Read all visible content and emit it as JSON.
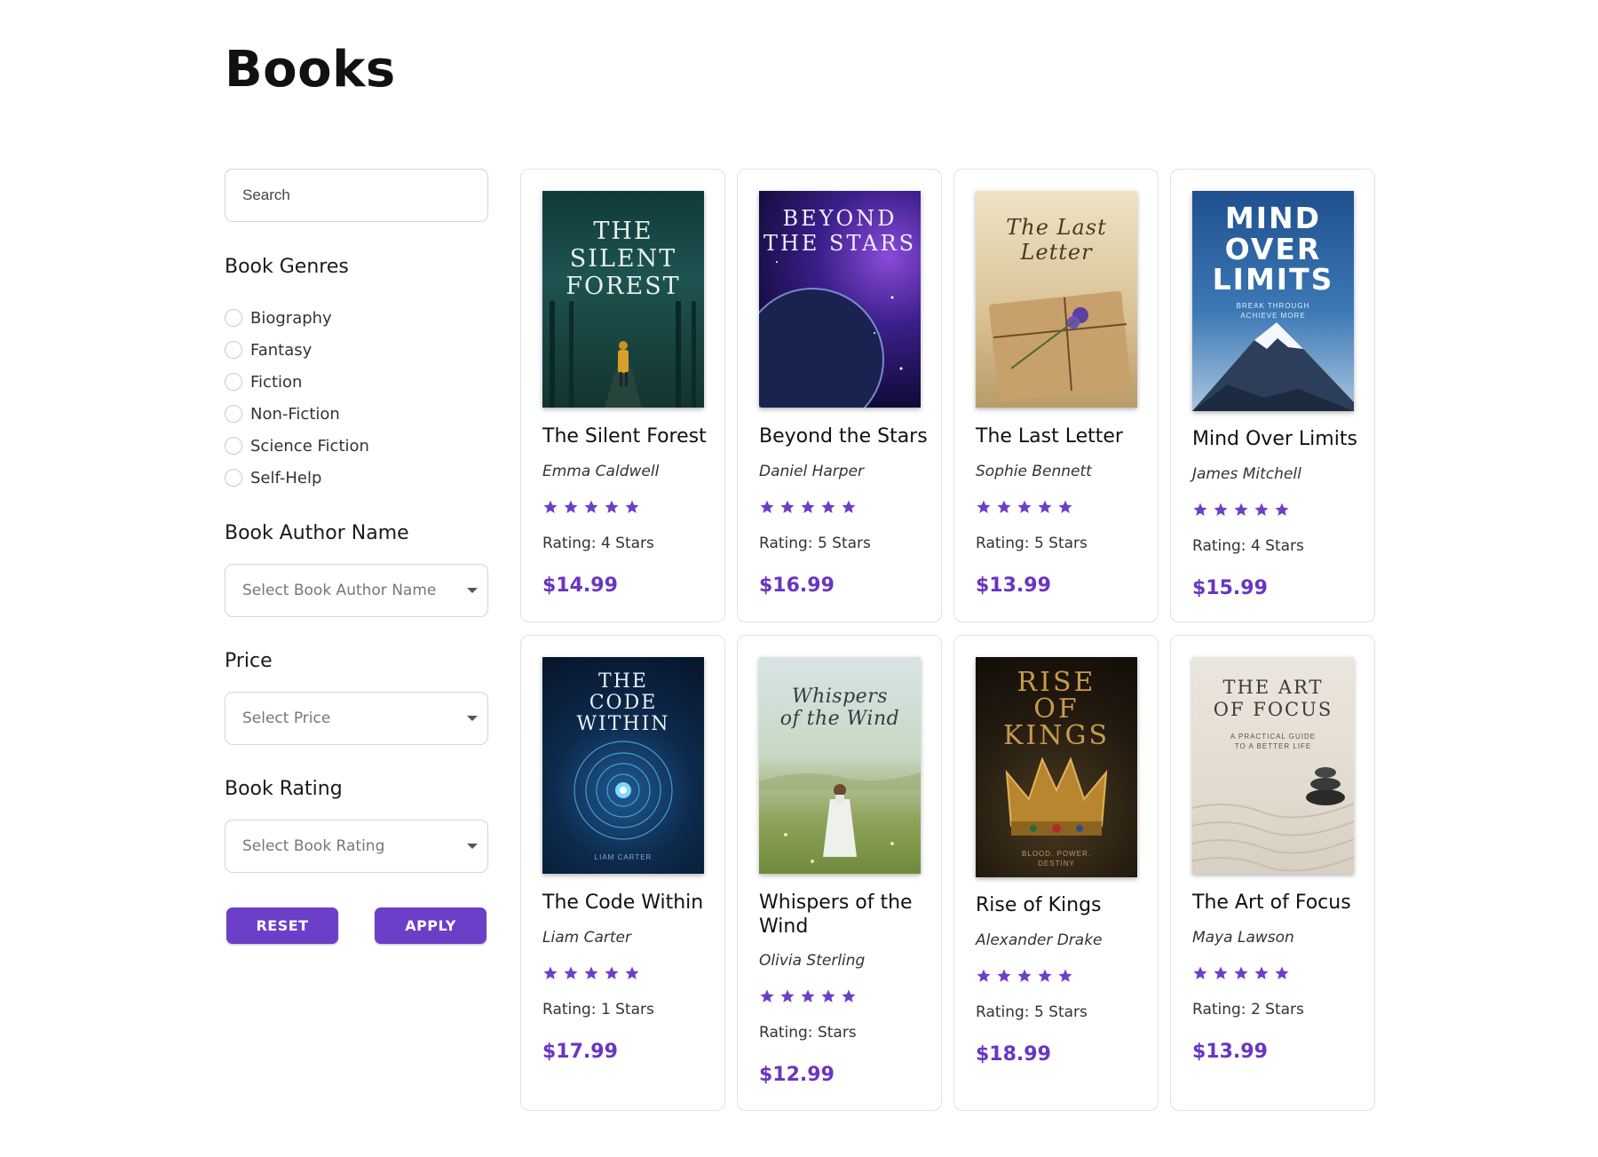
{
  "page": {
    "title": "Books"
  },
  "colors": {
    "accent": "#6c3fc9",
    "price": "#6a35c2",
    "border": "#e2e2e2"
  },
  "sidebar": {
    "search": {
      "placeholder": "Search",
      "value": ""
    },
    "genres": {
      "title": "Book Genres",
      "options": [
        "Biography",
        "Fantasy",
        "Fiction",
        "Non-Fiction",
        "Science Fiction",
        "Self-Help"
      ]
    },
    "author": {
      "title": "Book Author Name",
      "placeholder": "Select Book Author Name"
    },
    "price": {
      "title": "Price",
      "placeholder": "Select Price"
    },
    "rating": {
      "title": "Book Rating",
      "placeholder": "Select Book Rating"
    },
    "buttons": {
      "reset": "RESET",
      "apply": "APPLY"
    }
  },
  "books": [
    {
      "title": "The Silent Forest",
      "author": "Emma Caldwell",
      "stars": 5,
      "rating_text": "Rating: 4 Stars",
      "price": "$14.99",
      "cover": {
        "title": "THE\nSILENT\nFOREST",
        "subtitle": "",
        "theme": "forest"
      }
    },
    {
      "title": "Beyond the Stars",
      "author": "Daniel Harper",
      "stars": 5,
      "rating_text": "Rating: 5 Stars",
      "price": "$16.99",
      "cover": {
        "title": "BEYOND\nTHE STARS",
        "subtitle": "",
        "theme": "space"
      }
    },
    {
      "title": "The Last Letter",
      "author": "Sophie Bennett",
      "stars": 5,
      "rating_text": "Rating: 5 Stars",
      "price": "$13.99",
      "cover": {
        "title": "The Last\nLetter",
        "subtitle": "",
        "theme": "letter"
      }
    },
    {
      "title": "Mind Over Limits",
      "author": "James Mitchell",
      "stars": 5,
      "rating_text": "Rating: 4 Stars",
      "price": "$15.99",
      "cover": {
        "title": "MIND\nOVER\nLIMITS",
        "subtitle": "BREAK THROUGH\nACHIEVE MORE",
        "theme": "mountain"
      }
    },
    {
      "title": "The Code Within",
      "author": "Liam Carter",
      "stars": 5,
      "rating_text": "Rating: 1 Stars",
      "price": "$17.99",
      "cover": {
        "title": "THE\nCODE\nWITHIN",
        "subtitle": "LIAM CARTER",
        "theme": "code"
      }
    },
    {
      "title": "Whispers of the Wind",
      "author": "Olivia Sterling",
      "stars": 5,
      "rating_text": "Rating: Stars",
      "price": "$12.99",
      "cover": {
        "title": "Whispers\nof the Wind",
        "subtitle": "",
        "theme": "meadow"
      }
    },
    {
      "title": "Rise of Kings",
      "author": "Alexander Drake",
      "stars": 5,
      "rating_text": "Rating: 5 Stars",
      "price": "$18.99",
      "cover": {
        "title": "RISE\nOF\nKINGS",
        "subtitle": "BLOOD. POWER.\nDESTINY",
        "theme": "crown"
      }
    },
    {
      "title": "The Art of Focus",
      "author": "Maya Lawson",
      "stars": 5,
      "rating_text": "Rating: 2 Stars",
      "price": "$13.99",
      "cover": {
        "title": "THE ART\nOF FOCUS",
        "subtitle": "A PRACTICAL GUIDE\nTO A BETTER LIFE",
        "theme": "zen"
      }
    }
  ]
}
